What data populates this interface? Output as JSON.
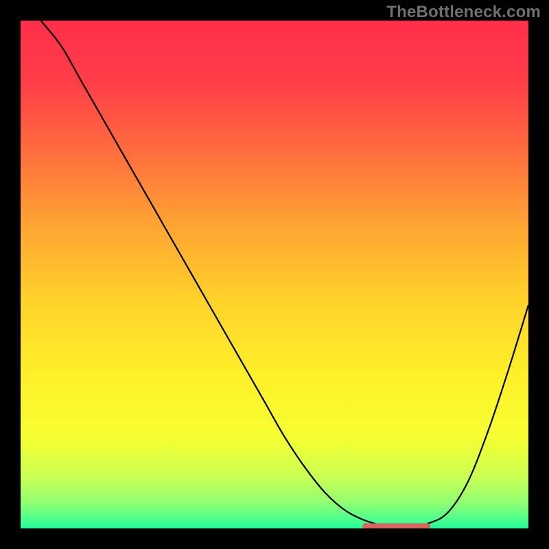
{
  "watermark": "TheBottleneck.com",
  "colors": {
    "gradient_stops": [
      {
        "offset": 0.0,
        "hex": "#ff2f4a"
      },
      {
        "offset": 0.12,
        "hex": "#ff3d48"
      },
      {
        "offset": 0.25,
        "hex": "#ff6a3f"
      },
      {
        "offset": 0.4,
        "hex": "#ffa333"
      },
      {
        "offset": 0.55,
        "hex": "#ffd22a"
      },
      {
        "offset": 0.7,
        "hex": "#fff029"
      },
      {
        "offset": 0.82,
        "hex": "#f6ff31"
      },
      {
        "offset": 0.9,
        "hex": "#c9ff54"
      },
      {
        "offset": 0.95,
        "hex": "#8fff72"
      },
      {
        "offset": 0.98,
        "hex": "#52ff8c"
      },
      {
        "offset": 1.0,
        "hex": "#20ff9a"
      }
    ],
    "curve": "#000000",
    "marker": "#d9635f"
  },
  "chart_data": {
    "type": "line",
    "title": "",
    "xlabel": "",
    "ylabel": "",
    "xlim": [
      0,
      100
    ],
    "ylim": [
      0,
      100
    ],
    "x": [
      4,
      8,
      12,
      16,
      20,
      24,
      28,
      32,
      36,
      40,
      44,
      48,
      52,
      56,
      60,
      64,
      68,
      72,
      74,
      76,
      80,
      84,
      88,
      92,
      96,
      100
    ],
    "values": [
      100,
      95,
      88,
      81,
      74,
      67,
      60,
      53,
      46,
      39,
      32,
      25,
      18,
      12,
      7,
      3.5,
      1.5,
      0.4,
      0.2,
      0.2,
      0.9,
      3,
      9,
      19,
      31,
      44
    ],
    "optimal_region": {
      "x_start": 68,
      "x_end": 80,
      "y": 0.4
    },
    "annotations": []
  }
}
